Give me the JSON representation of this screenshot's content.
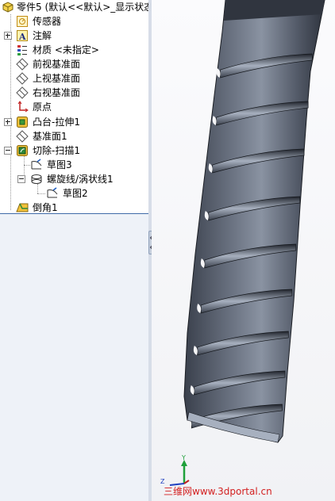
{
  "feature_tree": {
    "root_label": "零件5 (默认<<默认>_显示状态",
    "items": [
      {
        "label": "传感器"
      },
      {
        "label": "注解"
      },
      {
        "label": "材质 <未指定>"
      },
      {
        "label": "前视基准面"
      },
      {
        "label": "上视基准面"
      },
      {
        "label": "右视基准面"
      },
      {
        "label": "原点"
      },
      {
        "label": "凸台-拉伸1"
      },
      {
        "label": "基准面1"
      },
      {
        "label": "切除-扫描1"
      },
      {
        "label": "草图3"
      },
      {
        "label": "螺旋线/涡状线1"
      },
      {
        "label": "草图2"
      },
      {
        "label": "倒角1"
      }
    ]
  },
  "viewport": {
    "triad_y": "Y",
    "triad_z": "Z",
    "part_color": "#4e5563"
  },
  "watermark": "三维网www.3dportal.cn"
}
